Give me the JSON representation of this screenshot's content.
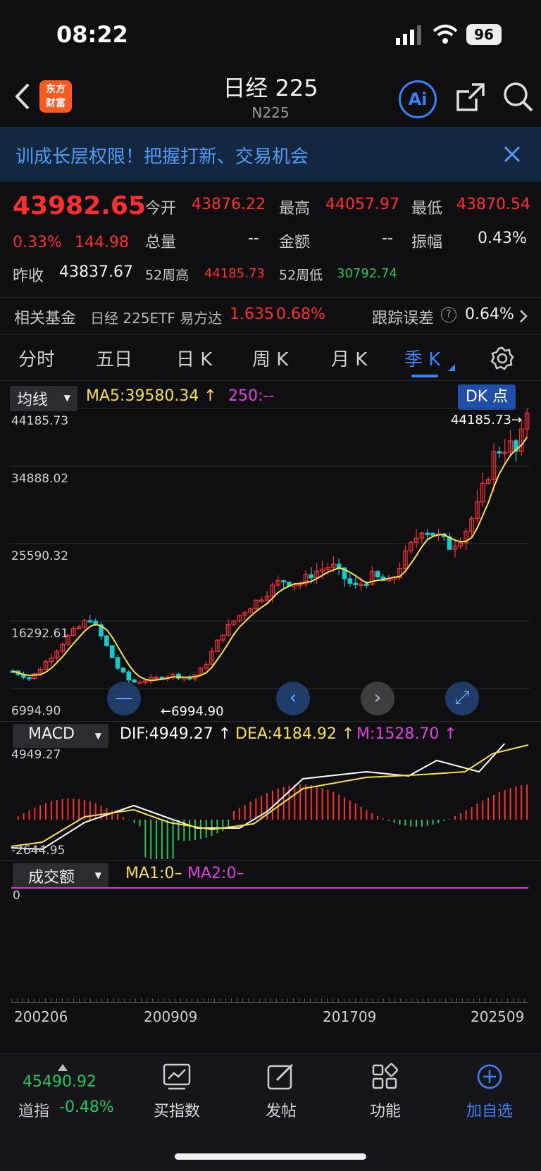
{
  "status": {
    "time": "08:22",
    "battery": "96"
  },
  "header": {
    "title": "日经 225",
    "code": "N225",
    "logo_line1": "东方",
    "logo_line2": "财富",
    "ai_label": "Ai"
  },
  "banner": {
    "text": "训成长层权限！把握打新、交易机会"
  },
  "quote": {
    "price": "43982.65",
    "change_pct": "0.33%",
    "change": "144.98",
    "open_label": "今开",
    "open": "43876.22",
    "high_label": "最高",
    "high": "44057.97",
    "low_label": "最低",
    "low": "43870.54",
    "volume_label": "总量",
    "volume": "--",
    "amount_label": "金额",
    "amount": "--",
    "amplitude_label": "振幅",
    "amplitude": "0.43%",
    "prev_close_label": "昨收",
    "prev_close": "43837.67",
    "high52_label": "52周高",
    "high52": "44185.73",
    "low52_label": "52周低",
    "low52": "30792.74"
  },
  "fund": {
    "label": "相关基金",
    "name": "日经 225ETF 易方达",
    "price": "1.635",
    "pct": "0.68%",
    "tracking_label": "跟踪误差",
    "tracking_value": "0.64%"
  },
  "tabs": [
    "分时",
    "五日",
    "日 K",
    "周 K",
    "月 K",
    "季 K"
  ],
  "chart": {
    "indicator": "均线",
    "ma5": "MA5:39580.34 ↑",
    "ma250": "250:--",
    "dk_label": "DK 点",
    "y_labels": [
      "44185.73",
      "34888.02",
      "25590.32",
      "16292.61",
      "6994.90"
    ],
    "max_marker": "44185.73→",
    "min_marker": "←6994.90",
    "macd": {
      "label": "MACD",
      "dif": "DIF:4949.27 ↑",
      "dea": "DEA:4184.92 ↑",
      "m": "M:1528.70 ↑",
      "top": "4949.27",
      "bottom": "-2644.95"
    },
    "volume": {
      "label": "成交额",
      "ma1": "MA1:0–",
      "ma2": "MA2:0–",
      "zero": "0"
    },
    "dates": [
      "200206",
      "200909",
      "201709",
      "202509"
    ],
    "colors": {
      "up": "#ff2f2f",
      "down": "#17c9c9",
      "ma5": "#f5e04a",
      "dif": "#ffffff",
      "dea": "#f5e04a",
      "m": "#e040e0"
    }
  },
  "chart_data": {
    "type": "line",
    "title": "",
    "xlabel": "",
    "ylabel": "",
    "ylim": [
      6994.9,
      44185.73
    ],
    "x": [
      "200206",
      "200909",
      "201709",
      "202509"
    ],
    "series": [
      {
        "name": "MA5",
        "values": [
          8800,
          12200,
          20100,
          39580.34
        ]
      }
    ]
  },
  "bottom": {
    "index_value": "45490.92",
    "index_label": "道指",
    "index_pct": "-0.48%",
    "nav": [
      "买指数",
      "发帖",
      "功能",
      "加自选"
    ]
  }
}
